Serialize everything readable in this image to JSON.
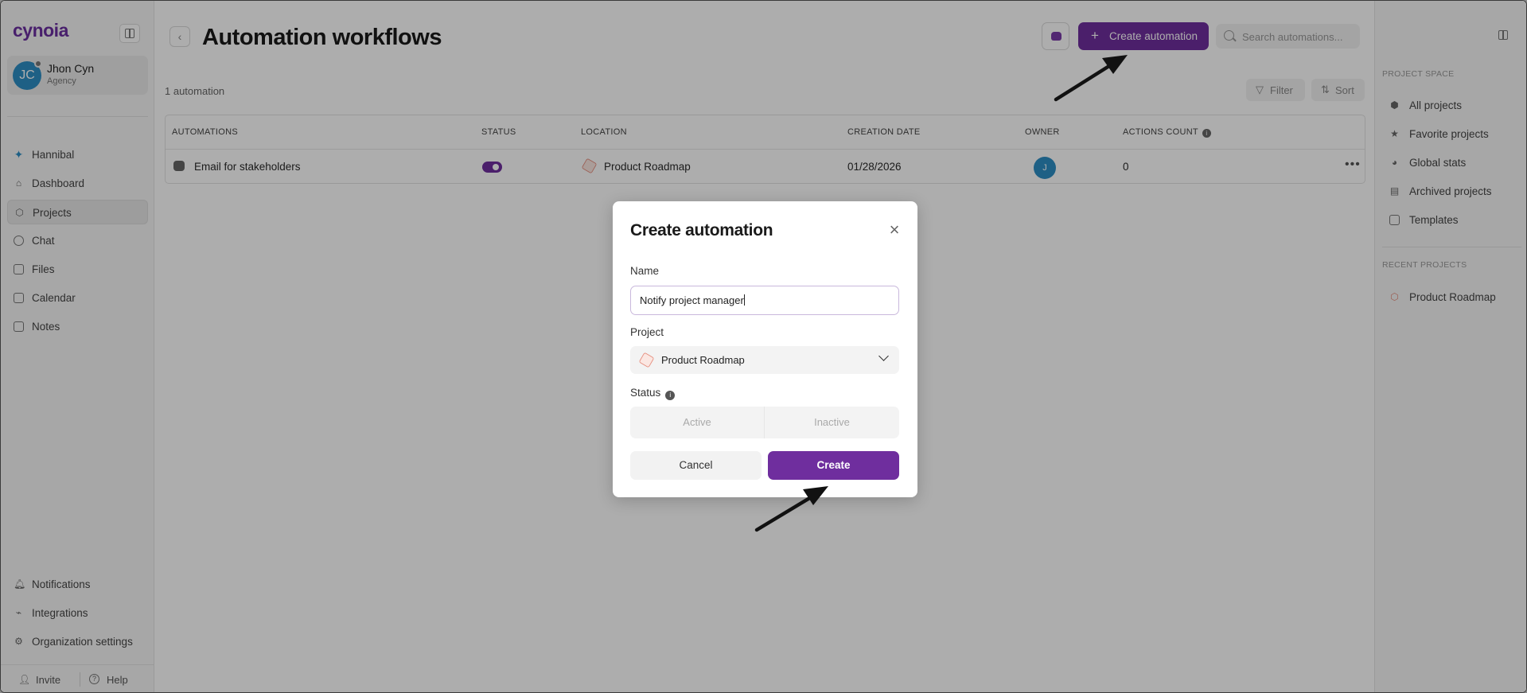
{
  "app": {
    "logo": "cynoia"
  },
  "user": {
    "initials": "JC",
    "name": "Jhon Cyn",
    "role": "Agency"
  },
  "sidebar": {
    "items": [
      {
        "label": "Hannibal",
        "icon": "sparkle-icon"
      },
      {
        "label": "Dashboard",
        "icon": "home-icon"
      },
      {
        "label": "Projects",
        "icon": "cube-icon",
        "active": true
      },
      {
        "label": "Chat",
        "icon": "chat-icon"
      },
      {
        "label": "Files",
        "icon": "folder-icon"
      },
      {
        "label": "Calendar",
        "icon": "calendar-icon"
      },
      {
        "label": "Notes",
        "icon": "note-icon"
      }
    ],
    "bottom_items": [
      {
        "label": "Notifications",
        "icon": "bell-icon"
      },
      {
        "label": "Integrations",
        "icon": "plug-icon"
      },
      {
        "label": "Organization settings",
        "icon": "gear-icon"
      }
    ],
    "invite_label": "Invite",
    "help_label": "Help"
  },
  "header": {
    "title": "Automation workflows",
    "create_label": "Create automation",
    "search_placeholder": "Search automations..."
  },
  "toolbar": {
    "count_text": "1 automation",
    "filter_label": "Filter",
    "sort_label": "Sort"
  },
  "table": {
    "headers": {
      "automations": "AUTOMATIONS",
      "status": "STATUS",
      "location": "LOCATION",
      "creation_date": "CREATION DATE",
      "owner": "OWNER",
      "actions_count": "ACTIONS COUNT"
    },
    "rows": [
      {
        "name": "Email for stakeholders",
        "status_on": true,
        "location": "Product Roadmap",
        "creation_date": "01/28/2026",
        "owner_initial": "J",
        "actions_count": "0"
      }
    ]
  },
  "right_panel": {
    "project_space_heading": "PROJECT SPACE",
    "items": [
      {
        "label": "All projects",
        "icon": "cube-icon"
      },
      {
        "label": "Favorite projects",
        "icon": "star-icon"
      },
      {
        "label": "Global stats",
        "icon": "pie-chart-icon"
      },
      {
        "label": "Archived projects",
        "icon": "archive-icon"
      },
      {
        "label": "Templates",
        "icon": "template-icon"
      }
    ],
    "recent_heading": "RECENT PROJECTS",
    "recent": [
      {
        "label": "Product Roadmap",
        "icon": "cube-icon"
      }
    ]
  },
  "modal": {
    "title": "Create automation",
    "name_label": "Name",
    "name_value": "Notify project manager",
    "project_label": "Project",
    "project_value": "Product Roadmap",
    "status_label": "Status",
    "status_options": [
      "Active",
      "Inactive"
    ],
    "cancel_label": "Cancel",
    "create_label": "Create"
  },
  "colors": {
    "accent": "#6f2e9e",
    "avatar": "#2d8ec4",
    "project_icon": "#e58a7a"
  }
}
